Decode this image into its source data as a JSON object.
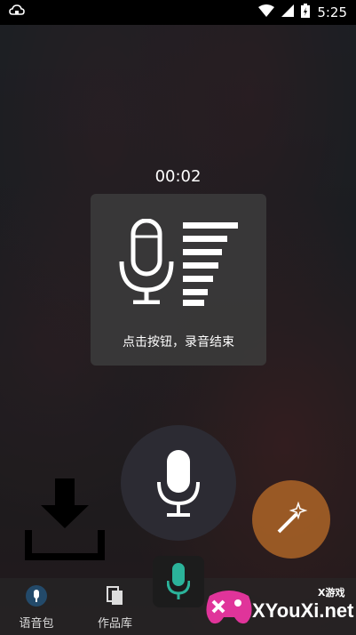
{
  "status": {
    "time": "5:25",
    "notification_icon": "cloud-lock-icon"
  },
  "recording": {
    "elapsed": "00:02",
    "hint": "点击按钮，录音结束"
  },
  "bottom_nav": [
    {
      "label": "语音包",
      "icon": "mic-icon"
    },
    {
      "label": "作品库",
      "icon": "works-icon"
    }
  ],
  "watermark": {
    "brand": "XYouXi.net",
    "tag": "X游戏"
  },
  "colors": {
    "accent_teal": "#2bb39a",
    "fab_orange": "#c47326"
  }
}
